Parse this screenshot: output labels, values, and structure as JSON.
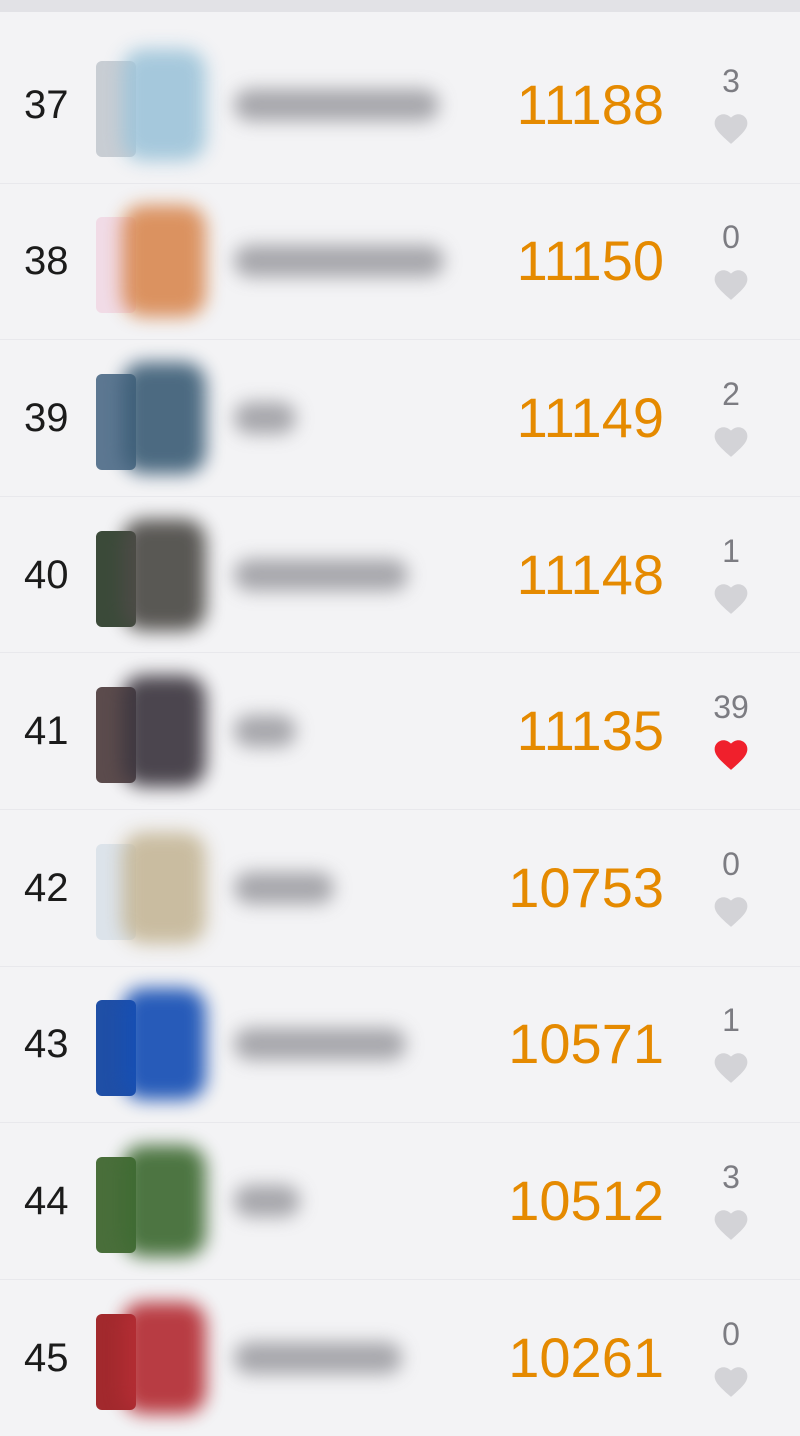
{
  "leaderboard": {
    "rows": [
      {
        "rank": "37",
        "score": "11188",
        "likes": "3",
        "liked": false,
        "avatar_colors": [
          "#c8cdd3",
          "#9fc5da"
        ],
        "name_width": 205
      },
      {
        "rank": "38",
        "score": "11150",
        "likes": "0",
        "liked": false,
        "avatar_colors": [
          "#f1dbe6",
          "#d98a54"
        ],
        "name_width": 210
      },
      {
        "rank": "39",
        "score": "11149",
        "likes": "2",
        "liked": false,
        "avatar_colors": [
          "#5c7791",
          "#3e5f78"
        ],
        "name_width": 62
      },
      {
        "rank": "40",
        "score": "11148",
        "likes": "1",
        "liked": false,
        "avatar_colors": [
          "#3b4a39",
          "#4d4b47"
        ],
        "name_width": 174
      },
      {
        "rank": "41",
        "score": "11135",
        "likes": "39",
        "liked": true,
        "avatar_colors": [
          "#5b4b4c",
          "#3d3740"
        ],
        "name_width": 62
      },
      {
        "rank": "42",
        "score": "10753",
        "likes": "0",
        "liked": false,
        "avatar_colors": [
          "#dce3ea",
          "#c6b899"
        ],
        "name_width": 100
      },
      {
        "rank": "43",
        "score": "10571",
        "likes": "1",
        "liked": false,
        "avatar_colors": [
          "#1f4fa6",
          "#164fb4"
        ],
        "name_width": 172
      },
      {
        "rank": "44",
        "score": "10512",
        "likes": "3",
        "liked": false,
        "avatar_colors": [
          "#496e3a",
          "#3f6b33"
        ],
        "name_width": 66
      },
      {
        "rank": "45",
        "score": "10261",
        "likes": "0",
        "liked": false,
        "avatar_colors": [
          "#a2292d",
          "#b42d34"
        ],
        "name_width": 168
      }
    ]
  },
  "colors": {
    "score": "#e58a00",
    "heart_inactive": "#d3d3d7",
    "heart_active": "#f0202c",
    "rank_text": "#1b1b1b",
    "like_count_text": "#7c7c82"
  },
  "icons": {
    "like": "heart-icon"
  }
}
